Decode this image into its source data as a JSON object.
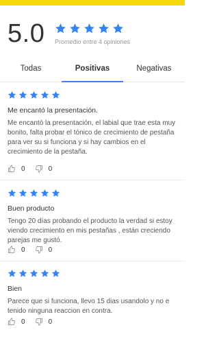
{
  "colors": {
    "accent": "#3483fa",
    "top_bar": "#fff159"
  },
  "summary": {
    "score": "5.0",
    "stars": 5,
    "subtitle": "Promedio entre 4 opiniones"
  },
  "tabs": [
    {
      "label": "Todas",
      "active": false
    },
    {
      "label": "Positivas",
      "active": true
    },
    {
      "label": "Negativas",
      "active": false
    }
  ],
  "reviews": [
    {
      "stars": 5,
      "title": "Me encantó la presentación.",
      "body": "Me encantó la presentación, el labial que trae esta muy bonito, falta probar el tónico de crecimiento de pestaña para ver su si funciona y si hay cambios en el crecimiento de la pestaña.",
      "likes": "0",
      "dislikes": "0"
    },
    {
      "stars": 5,
      "title": "Buen producto",
      "body": "Tengo 20 días probando  el producto la verdad si estoy viendo crecimiento en mis pestañas , están creciendo parejas   me gustó.",
      "likes": "0",
      "dislikes": "0"
    },
    {
      "stars": 5,
      "title": "Bien",
      "body": "Parece que si funciona, llevo 15 dias usandolo y no e tenido ninguna reaccion en contra.",
      "likes": "0",
      "dislikes": "0"
    }
  ],
  "icons": {
    "star": "star-icon",
    "like": "thumbs-up-icon",
    "dislike": "thumbs-down-icon"
  }
}
